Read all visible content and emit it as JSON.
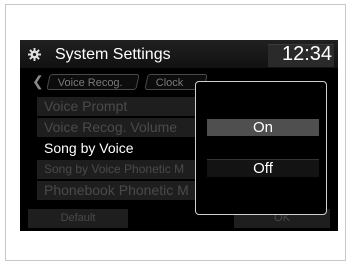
{
  "titlebar": {
    "title": "System Settings",
    "clock": "12:34",
    "icon": "gear-icon"
  },
  "tabs": [
    {
      "label": "Voice Recog."
    },
    {
      "label": "Clock"
    }
  ],
  "settings_list": [
    {
      "label": "Voice Prompt",
      "state": "dimmed"
    },
    {
      "label": "Voice Recog. Volume",
      "state": "dimmed"
    },
    {
      "label": "Song by Voice",
      "state": "selected"
    },
    {
      "label": "Song by Voice Phonetic M",
      "state": "dimmed"
    },
    {
      "label": "Phonebook Phonetic M",
      "state": "dimmed"
    }
  ],
  "footer": {
    "default_label": "Default",
    "ok_label": "OK"
  },
  "popup": {
    "options": [
      {
        "label": "On",
        "highlighted": true
      },
      {
        "label": "Off",
        "highlighted": false
      }
    ]
  },
  "colors": {
    "screen_bg": "#000000",
    "highlight": "#4f4f4f",
    "dimmed_text": "#4a4a4a"
  }
}
